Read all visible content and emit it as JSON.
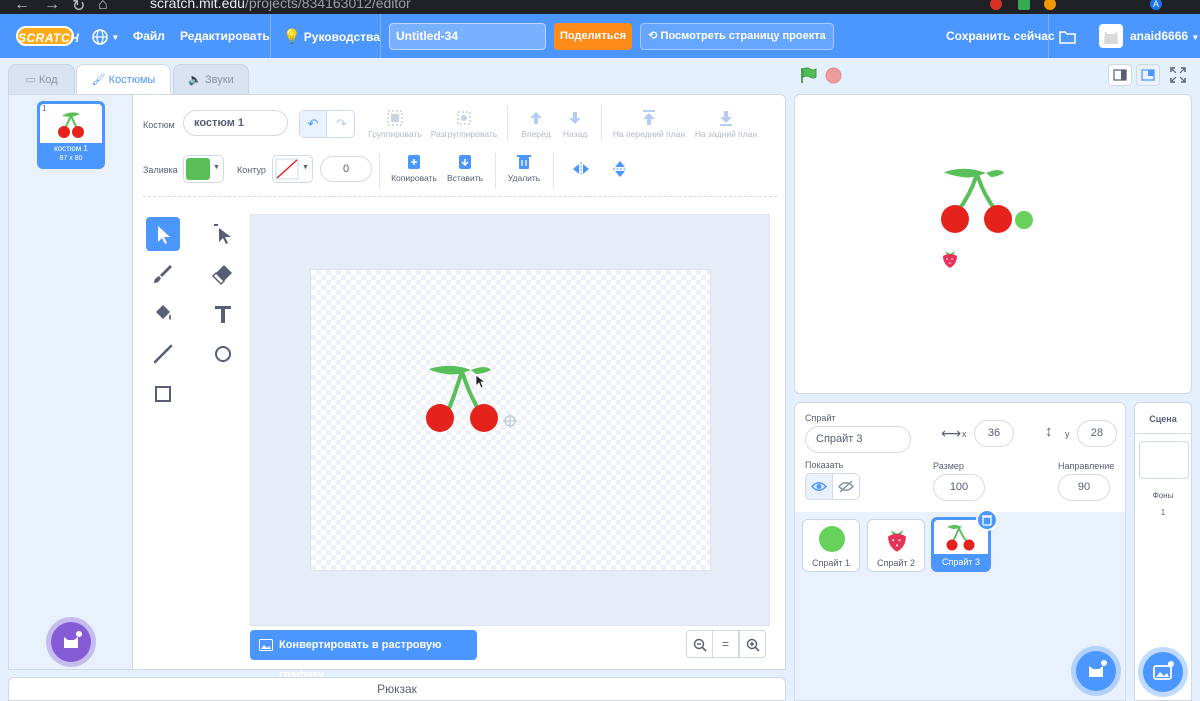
{
  "browser": {
    "url_host": "scratch.mit.edu",
    "url_path": "/projects/834163012/editor",
    "profile_initial": "A"
  },
  "menubar": {
    "logo": "SCRATCH",
    "file": "Файл",
    "edit": "Редактировать",
    "tutorials": "Руководства",
    "project_title": "Untitled-34",
    "share": "Поделиться",
    "see_project_page": "Посмотреть страницу проекта",
    "save_now": "Сохранить сейчас",
    "username": "anaid6666"
  },
  "tabs": {
    "code": "Код",
    "costumes": "Костюмы",
    "sounds": "Звуки"
  },
  "costume_list": [
    {
      "number": "1",
      "name": "костюм 1",
      "size": "87 x 80"
    }
  ],
  "paint_editor": {
    "costume_label": "Костюм",
    "costume_name": "костюм 1",
    "group": "Группировать",
    "ungroup": "Разгруппировать",
    "forward": "Вперёд",
    "backward": "Назад",
    "front": "На передний план",
    "back": "На задний план",
    "fill_label": "Заливка",
    "outline_label": "Контур",
    "outline_width": "0",
    "fill_color": "#59c059",
    "copy": "Копировать",
    "paste": "Вставить",
    "delete": "Удалить",
    "convert": "Конвертировать в растровую графику",
    "zoom_reset": "="
  },
  "backpack": "Рюкзак",
  "sprite_info": {
    "sprite_label": "Спрайт",
    "sprite_name": "Спрайт 3",
    "x_label": "x",
    "x_value": "36",
    "y_label": "y",
    "y_value": "28",
    "show_label": "Показать",
    "size_label": "Размер",
    "size_value": "100",
    "direction_label": "Направление",
    "direction_value": "90"
  },
  "sprites": [
    {
      "name": "Спрайт 1",
      "selected": false
    },
    {
      "name": "Спрайт 2",
      "selected": false
    },
    {
      "name": "Спрайт 3",
      "selected": true
    }
  ],
  "stage_pane": {
    "title": "Сцена",
    "backdrops_label": "Фоны",
    "backdrops_count": "1"
  },
  "colors": {
    "menubar": "#4c97ff",
    "share": "#ff8c1a",
    "cherry": "#e6221d",
    "leaf": "#59c059",
    "extension_fab": "#855cd6"
  }
}
